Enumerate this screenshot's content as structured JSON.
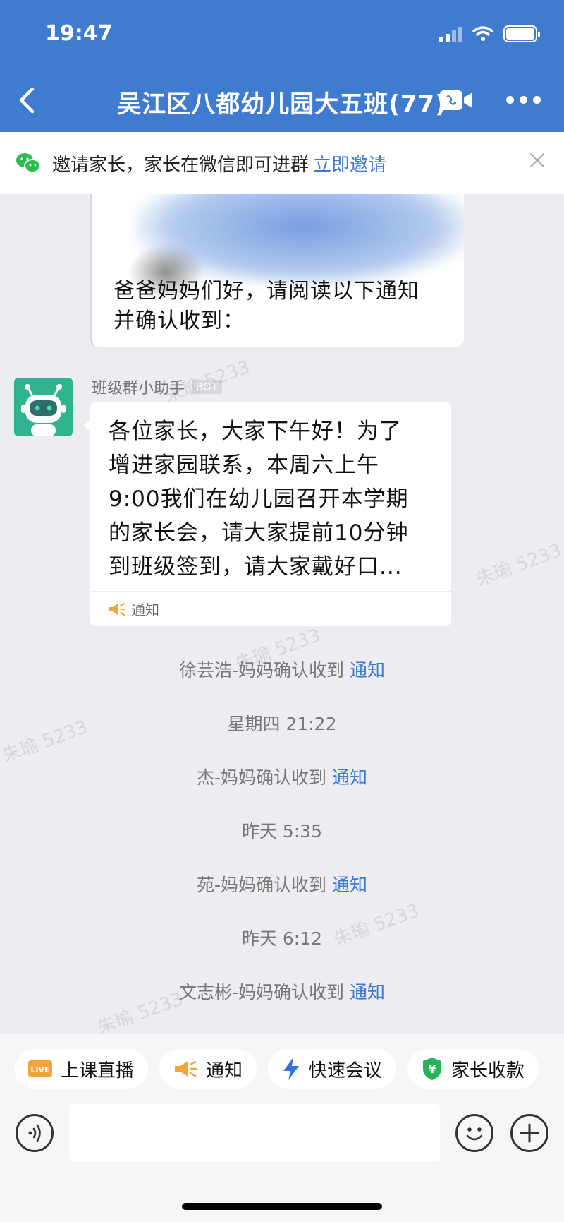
{
  "status_bar": {
    "time": "19:47"
  },
  "header": {
    "title": "吴江区八都幼儿园大五班(77)"
  },
  "invite_banner": {
    "text": "邀请家长，家长在微信即可进群",
    "link": "立即邀请"
  },
  "previous_message": {
    "lines": [
      "爸爸妈妈们好，请阅读以下通知",
      "并确认收到："
    ]
  },
  "bot_message": {
    "sender": "班级群小助手",
    "badge": "BOT",
    "lines": [
      "各位家长，大家下午好！为了",
      "增进家园联系，本周六上午",
      "9:00我们在幼儿园召开本学期",
      "的家长会，请大家提前10分钟",
      "到班级签到，请大家戴好口..."
    ],
    "footer_label": "通知"
  },
  "system_messages": [
    {
      "type": "confirm",
      "name": "徐芸浩-妈妈确认收到",
      "link": "通知"
    },
    {
      "type": "time",
      "text": "星期四 21:22"
    },
    {
      "type": "confirm",
      "name": "杰-妈妈确认收到",
      "link": "通知"
    },
    {
      "type": "time",
      "text": "昨天 5:35"
    },
    {
      "type": "confirm",
      "name": "苑-妈妈确认收到",
      "link": "通知"
    },
    {
      "type": "time",
      "text": "昨天 6:12"
    },
    {
      "type": "confirm",
      "name": "文志彬-妈妈确认收到",
      "link": "通知"
    }
  ],
  "watermark_text": "朱瑜 5233",
  "quick_actions": [
    {
      "label": "上课直播",
      "icon": "live-icon"
    },
    {
      "label": "通知",
      "icon": "megaphone-icon"
    },
    {
      "label": "快速会议",
      "icon": "lightning-icon"
    },
    {
      "label": "家长收款",
      "icon": "payment-shield-icon"
    }
  ],
  "input": {
    "placeholder": ""
  },
  "colors": {
    "header": "#3f7ccf",
    "link": "#3a78d2",
    "bot_avatar": "#2fb48f",
    "notice_orange": "#f2a33a"
  }
}
